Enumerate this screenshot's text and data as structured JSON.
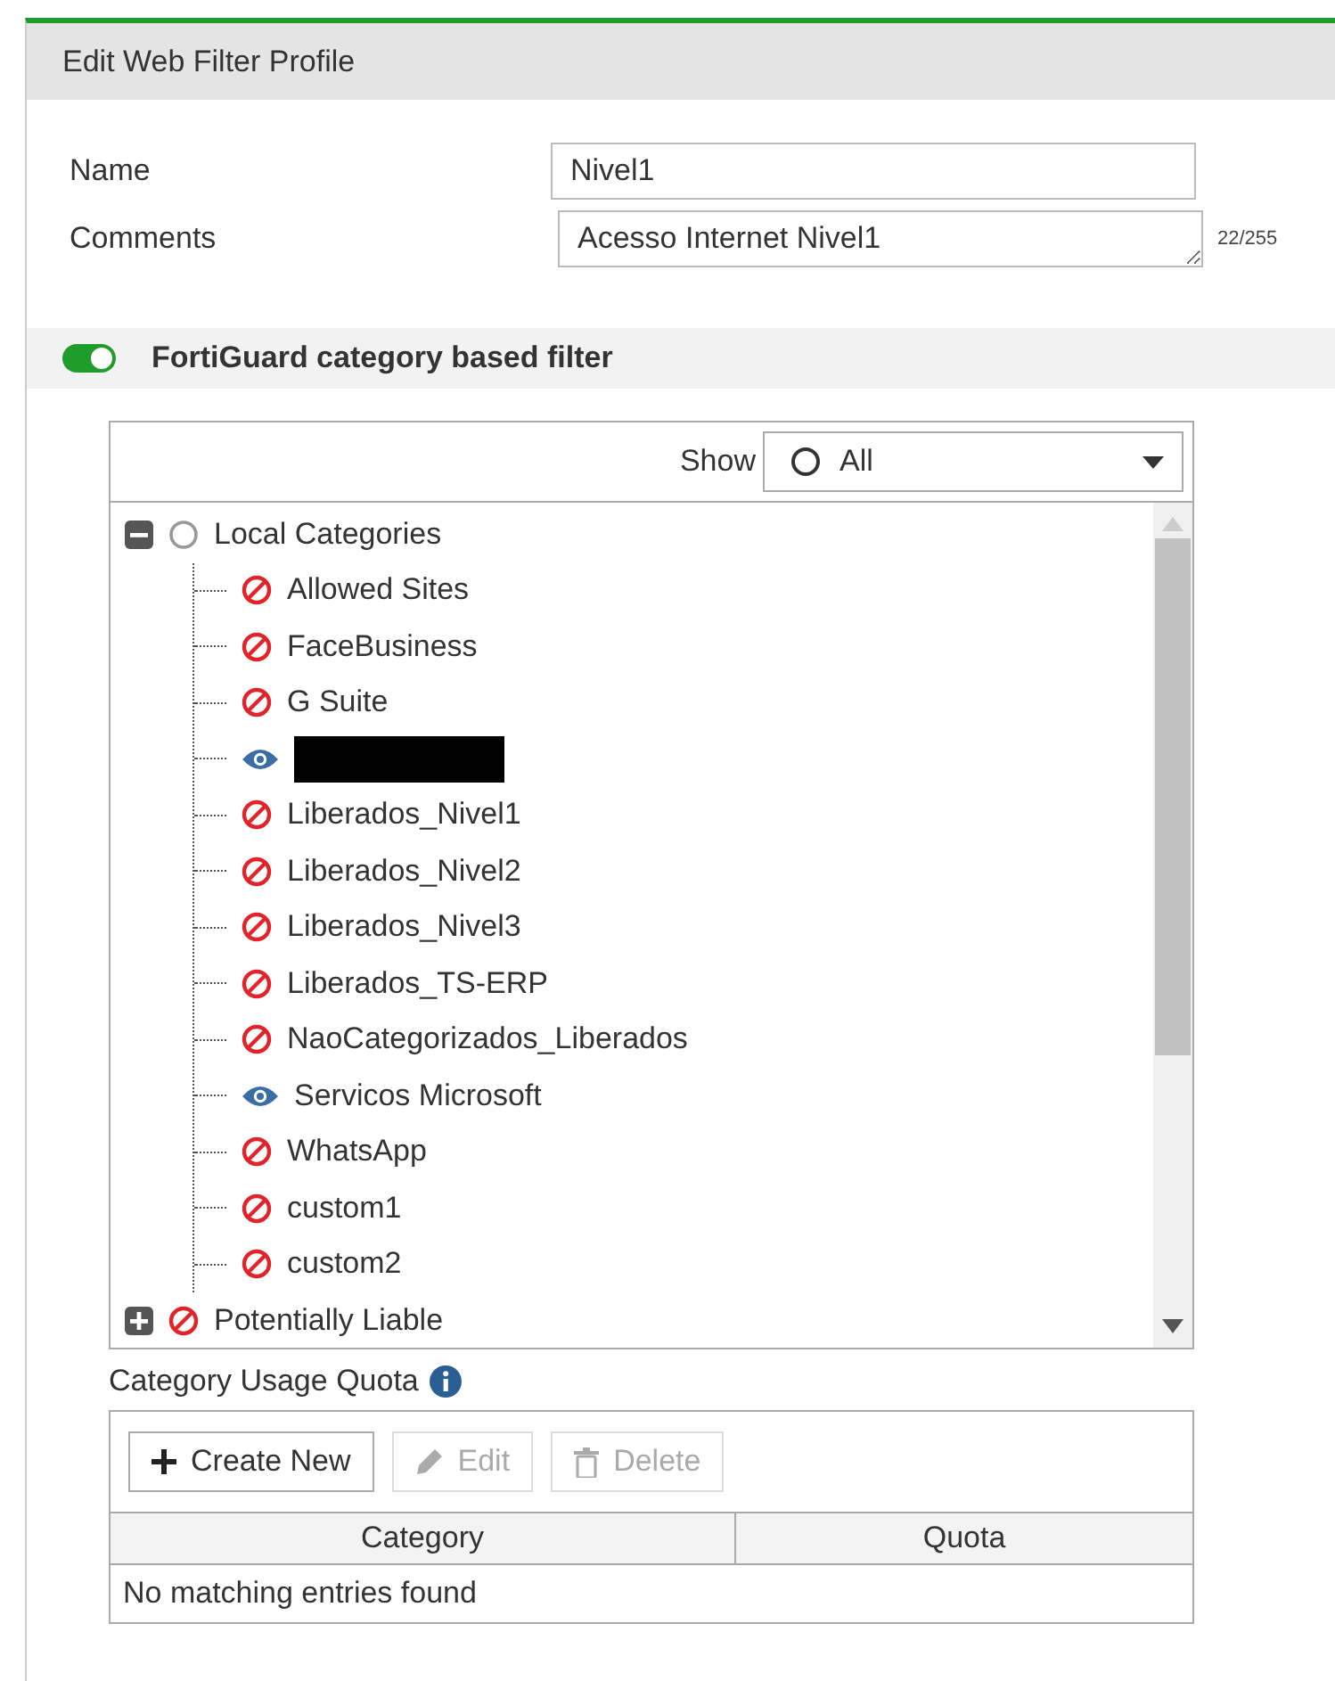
{
  "header": {
    "title": "Edit Web Filter Profile"
  },
  "fields": [
    {
      "label": "Name",
      "kind": "input",
      "value": "Nivel1"
    },
    {
      "label": "Comments",
      "kind": "textarea",
      "value": "Acesso Internet Nivel1",
      "counter": "22/255"
    }
  ],
  "section": {
    "label": "FortiGuard category based filter",
    "on": true
  },
  "tree": {
    "show_label": "Show",
    "show_value": "All",
    "nodes": [
      {
        "label": "Local Categories",
        "kind": "none",
        "expanded": true,
        "children": [
          {
            "label": "Allowed Sites",
            "kind": "block"
          },
          {
            "label": "FaceBusiness",
            "kind": "block"
          },
          {
            "label": "G Suite",
            "kind": "block"
          },
          {
            "kind": "monitor",
            "redacted": true
          },
          {
            "label": "Liberados_Nivel1",
            "kind": "block"
          },
          {
            "label": "Liberados_Nivel2",
            "kind": "block"
          },
          {
            "label": "Liberados_Nivel3",
            "kind": "block"
          },
          {
            "label": "Liberados_TS-ERP",
            "kind": "block"
          },
          {
            "label": "NaoCategorizados_Liberados",
            "kind": "block"
          },
          {
            "label": "Servicos Microsoft",
            "kind": "monitor"
          },
          {
            "label": "WhatsApp",
            "kind": "block"
          },
          {
            "label": "custom1",
            "kind": "block"
          },
          {
            "label": "custom2",
            "kind": "block"
          }
        ]
      },
      {
        "label": "Potentially Liable",
        "kind": "block",
        "expanded": false
      }
    ]
  },
  "quota": {
    "title": "Category Usage Quota",
    "buttons": [
      {
        "label": "Create New",
        "disabled": false
      },
      {
        "label": "Edit",
        "disabled": true
      },
      {
        "label": "Delete",
        "disabled": true
      }
    ],
    "columns": [
      "Category",
      "Quota"
    ],
    "empty": "No matching entries found"
  }
}
